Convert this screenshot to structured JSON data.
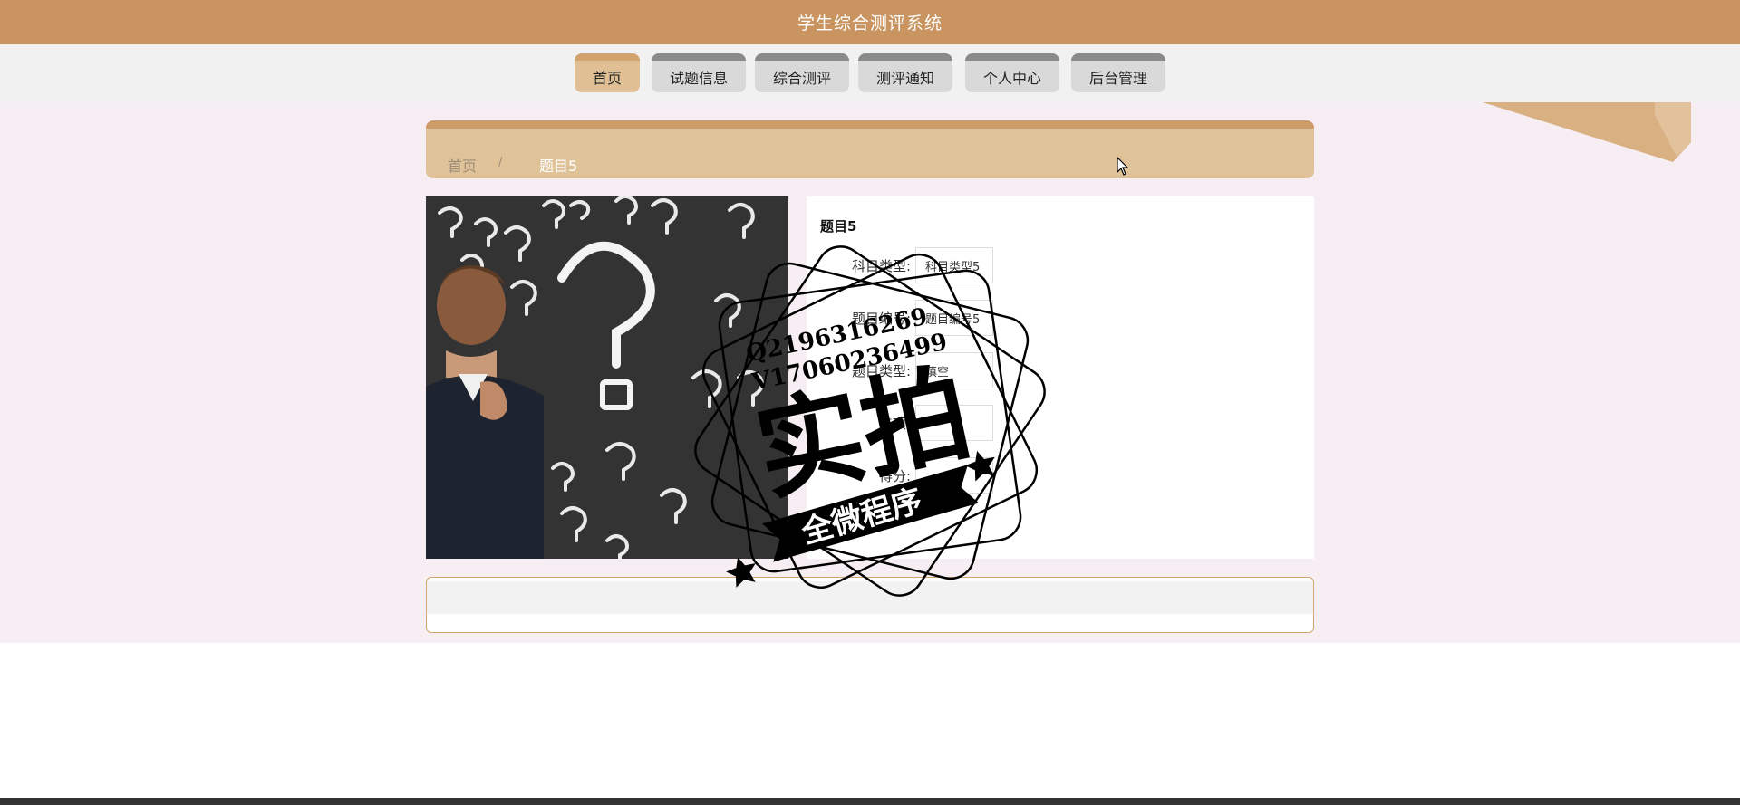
{
  "app": {
    "title": "学生综合测评系统"
  },
  "nav": {
    "items": [
      {
        "label": "首页",
        "active": true
      },
      {
        "label": "试题信息",
        "active": false
      },
      {
        "label": "综合测评",
        "active": false
      },
      {
        "label": "测评通知",
        "active": false
      },
      {
        "label": "个人中心",
        "active": false
      },
      {
        "label": "后台管理",
        "active": false
      }
    ]
  },
  "breadcrumb": {
    "home": "首页",
    "separator": "/",
    "current": "题目5"
  },
  "detail": {
    "title": "题目5",
    "fields": [
      {
        "label": "科目类型:",
        "value": "科目类型5"
      },
      {
        "label": "题目编号:",
        "value": "题目编号5"
      },
      {
        "label": "题目类型:",
        "value": "填空"
      },
      {
        "label": "选项:",
        "value": ""
      },
      {
        "label": "得分:",
        "value": ""
      }
    ]
  },
  "watermark": {
    "qq": "Q2196316269",
    "wechat": "V17060236499",
    "main": "实拍",
    "banner": "全微程序"
  },
  "colors": {
    "topbar": "#c99460",
    "breadcrumb_bg": "#dfc297",
    "nav_active": "#dfbf93",
    "page_bg": "#f6eef2"
  }
}
